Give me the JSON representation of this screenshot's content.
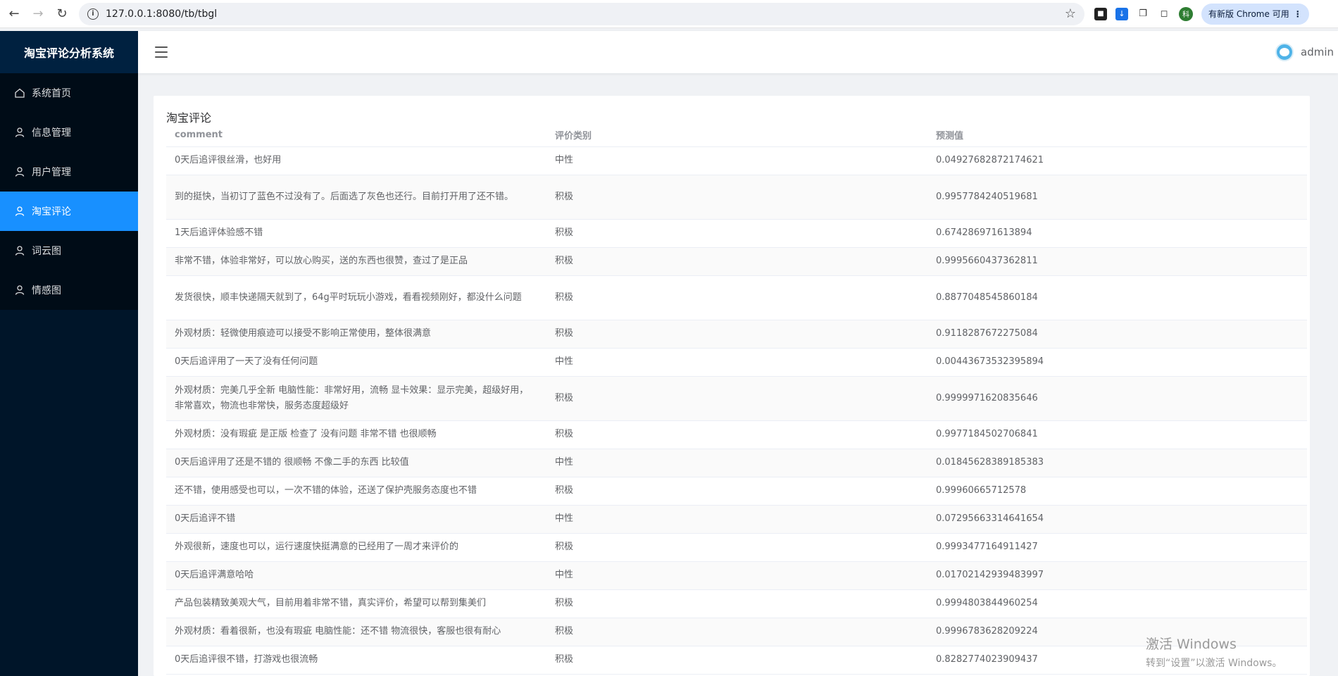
{
  "browser": {
    "url": "127.0.0.1:8080/tb/tbgl",
    "profile_letter": "科",
    "update_label": "有新版 Chrome 可用"
  },
  "sidebar": {
    "brand": "淘宝评论分析系统",
    "items": [
      {
        "label": "系统首页",
        "icon": "home-icon",
        "active": false
      },
      {
        "label": "信息管理",
        "icon": "user-icon",
        "active": false
      },
      {
        "label": "用户管理",
        "icon": "user-icon",
        "active": false
      },
      {
        "label": "淘宝评论",
        "icon": "user-icon",
        "active": true
      },
      {
        "label": "词云图",
        "icon": "user-icon",
        "active": false
      },
      {
        "label": "情感图",
        "icon": "user-icon",
        "active": false
      }
    ]
  },
  "header": {
    "username": "admin"
  },
  "main": {
    "title": "淘宝评论",
    "columns": [
      "comment",
      "评价类别",
      "预测值"
    ],
    "rows": [
      {
        "comment": "0天后追评很丝滑，也好用",
        "category": "中性",
        "value": "0.04927682872174621"
      },
      {
        "comment": "到的挺快，当初订了蓝色不过没有了。后面选了灰色也还行。目前打开用了还不错。",
        "category": "积极",
        "value": "0.9957784240519681"
      },
      {
        "comment": "1天后追评体验感不错",
        "category": "积极",
        "value": "0.674286971613894"
      },
      {
        "comment": "非常不错，体验非常好，可以放心购买，送的东西也很赞，查过了是正品",
        "category": "积极",
        "value": "0.9995660437362811"
      },
      {
        "comment": "发货很快，顺丰快递隔天就到了，64g平时玩玩小游戏，看看视频刚好，都没什么问题",
        "category": "积极",
        "value": "0.8877048545860184"
      },
      {
        "comment": "外观材质：轻微使用痕迹可以接受不影响正常使用，整体很满意",
        "category": "积极",
        "value": "0.9118287672275084"
      },
      {
        "comment": "0天后追评用了一天了没有任何问题",
        "category": "中性",
        "value": "0.00443673532395894"
      },
      {
        "comment": "外观材质：完美几乎全新 电脑性能：非常好用，流畅 显卡效果：显示完美，超级好用，非常喜欢，物流也非常快，服务态度超级好",
        "category": "积极",
        "value": "0.9999971620835646"
      },
      {
        "comment": "外观材质：没有瑕疵 是正版 检查了 没有问题 非常不错 也很顺畅",
        "category": "积极",
        "value": "0.9977184502706841"
      },
      {
        "comment": "0天后追评用了还是不错的 很顺畅 不像二手的东西 比较值",
        "category": "中性",
        "value": "0.01845628389185383"
      },
      {
        "comment": "还不错，使用感受也可以，一次不错的体验，还送了保护壳服务态度也不错",
        "category": "积极",
        "value": "0.99960665712578"
      },
      {
        "comment": "0天后追评不错",
        "category": "中性",
        "value": "0.07295663314641654"
      },
      {
        "comment": "外观很新，速度也可以，运行速度快挺满意的已经用了一周才来评价的",
        "category": "积极",
        "value": "0.9993477164911427"
      },
      {
        "comment": "0天后追评满意哈哈",
        "category": "中性",
        "value": "0.01702142939483997"
      },
      {
        "comment": "产品包装精致美观大气，目前用着非常不错，真实评价，希望可以帮到集美们",
        "category": "积极",
        "value": "0.9994803844960254"
      },
      {
        "comment": "外观材质：看着很新，也没有瑕疵 电脑性能：还不错 物流很快，客服也很有耐心",
        "category": "积极",
        "value": "0.9996783628209224"
      },
      {
        "comment": "0天后追评很不错，打游戏也很流畅",
        "category": "积极",
        "value": "0.8282774023909437"
      }
    ]
  },
  "watermark": {
    "line1": "激活 Windows",
    "line2": "转到“设置”以激活 Windows。"
  }
}
